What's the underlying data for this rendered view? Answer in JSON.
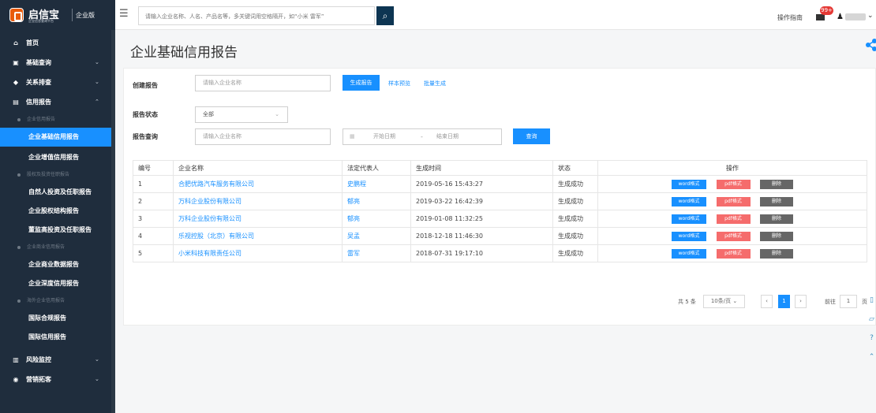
{
  "brand": {
    "name": "启信宝",
    "tagline": "企业信息查询平台",
    "edition": "企业版"
  },
  "search": {
    "placeholder": "请输入企业名称、人名、产品名等，多关键词用空格隔开，如“小米 雷军”"
  },
  "header": {
    "guide": "操作指南",
    "badge": "99+"
  },
  "nav": {
    "home": "首页",
    "basic": "基础查询",
    "relation": "关系排查",
    "credit": "信用报告",
    "risk": "风险监控",
    "marketing": "营销拓客",
    "groups": {
      "enterprise_credit": "企业信用报告",
      "equity": "股权及投资任职报告",
      "business": "企业商业信用报告",
      "overseas": "海外企业信用报告"
    },
    "items": {
      "basic_report": "企业基础信用报告",
      "value_report": "企业增值信用报告",
      "person_report": "自然人投资及任职报告",
      "equity_report": "企业股权结构报告",
      "management_report": "董监高投资及任职报告",
      "business_data": "企业商业数据报告",
      "deep_report": "企业深度信用报告",
      "compliance": "国际合规报告",
      "international": "国际信用报告"
    }
  },
  "page": {
    "title": "企业基础信用报告",
    "create_label": "创建报告",
    "company_placeholder": "请输入企业名称",
    "generate": "生成报告",
    "sample": "样本预览",
    "batch": "批量生成",
    "status_label": "报告状态",
    "status_value": "全部",
    "query_label": "报告查询",
    "start_date": "开始日期",
    "end_date": "结束日期",
    "query": "查询"
  },
  "table": {
    "headers": [
      "编号",
      "企业名称",
      "法定代表人",
      "生成时间",
      "状态",
      "操作"
    ],
    "rows": [
      {
        "id": "1",
        "company": "合肥优路汽车服务有限公司",
        "rep": "史鹏程",
        "time": "2019-05-16 15:43:27",
        "status": "生成成功"
      },
      {
        "id": "2",
        "company": "万科企业股份有限公司",
        "rep": "郁亮",
        "time": "2019-03-22 16:42:39",
        "status": "生成成功"
      },
      {
        "id": "3",
        "company": "万科企业股份有限公司",
        "rep": "郁亮",
        "time": "2019-01-08 11:32:25",
        "status": "生成成功"
      },
      {
        "id": "4",
        "company": "乐视控股（北京）有限公司",
        "rep": "吴孟",
        "time": "2018-12-18 11:46:30",
        "status": "生成成功"
      },
      {
        "id": "5",
        "company": "小米科技有限责任公司",
        "rep": "雷军",
        "time": "2018-07-31 19:17:10",
        "status": "生成成功"
      }
    ],
    "actions": {
      "word": "word格式",
      "pdf": "pdf格式",
      "delete": "删除"
    }
  },
  "pagination": {
    "total": "共 5 条",
    "page_size": "10条/页",
    "current": "1",
    "goto": "前往",
    "goto_value": "1",
    "page_unit": "页"
  },
  "colors": {
    "accent": "#1890ff",
    "sidebar": "#1f2d3d",
    "danger": "#f56c6c"
  },
  "icons": [
    "home-icon",
    "database-icon",
    "relation-icon",
    "report-icon",
    "risk-icon",
    "marketing-icon",
    "search-icon",
    "mail-icon",
    "user-icon",
    "share-icon"
  ]
}
